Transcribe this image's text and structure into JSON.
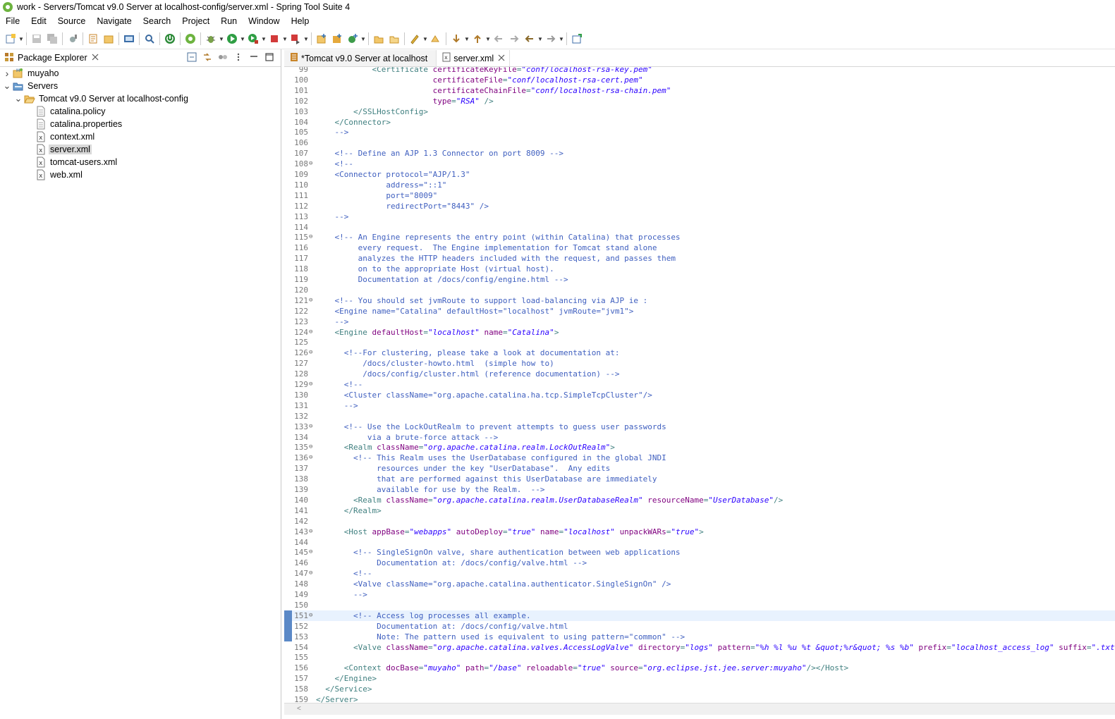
{
  "window": {
    "title": "work - Servers/Tomcat v9.0 Server at localhost-config/server.xml - Spring Tool Suite 4"
  },
  "menu": [
    "File",
    "Edit",
    "Source",
    "Navigate",
    "Search",
    "Project",
    "Run",
    "Window",
    "Help"
  ],
  "package_explorer": {
    "title": "Package Explorer",
    "tree": [
      {
        "label": "muyaho",
        "depth": 0,
        "expanded": false,
        "icon": "project-icon"
      },
      {
        "label": "Servers",
        "depth": 0,
        "expanded": true,
        "icon": "folder-icon"
      },
      {
        "label": "Tomcat v9.0 Server at localhost-config",
        "depth": 1,
        "expanded": true,
        "icon": "folder-open-icon"
      },
      {
        "label": "catalina.policy",
        "depth": 2,
        "icon": "file-icon"
      },
      {
        "label": "catalina.properties",
        "depth": 2,
        "icon": "file-icon"
      },
      {
        "label": "context.xml",
        "depth": 2,
        "icon": "xml-file-icon"
      },
      {
        "label": "server.xml",
        "depth": 2,
        "icon": "xml-file-icon",
        "selected": true
      },
      {
        "label": "tomcat-users.xml",
        "depth": 2,
        "icon": "xml-file-icon"
      },
      {
        "label": "web.xml",
        "depth": 2,
        "icon": "xml-file-icon"
      }
    ]
  },
  "editor": {
    "tabs": [
      {
        "label": "*Tomcat v9.0 Server at localhost",
        "active": false
      },
      {
        "label": "server.xml",
        "active": true
      }
    ],
    "current_line": 151,
    "lines": [
      {
        "n": "99",
        "fold": "",
        "parts": [
          [
            "c",
            "            "
          ],
          [
            "t",
            "<Certificate "
          ],
          [
            "a",
            "certificateKeyFile"
          ],
          [
            "t",
            "="
          ],
          [
            "v",
            "\"conf/localhost-rsa-key.pem\""
          ]
        ]
      },
      {
        "n": "100",
        "fold": "",
        "parts": [
          [
            "c",
            "                         "
          ],
          [
            "a",
            "certificateFile"
          ],
          [
            "t",
            "="
          ],
          [
            "v",
            "\"conf/localhost-rsa-cert.pem\""
          ]
        ]
      },
      {
        "n": "101",
        "fold": "",
        "parts": [
          [
            "c",
            "                         "
          ],
          [
            "a",
            "certificateChainFile"
          ],
          [
            "t",
            "="
          ],
          [
            "v",
            "\"conf/localhost-rsa-chain.pem\""
          ]
        ]
      },
      {
        "n": "102",
        "fold": "",
        "parts": [
          [
            "c",
            "                         "
          ],
          [
            "a",
            "type"
          ],
          [
            "t",
            "="
          ],
          [
            "v",
            "\"RSA\""
          ],
          [
            "t",
            " />"
          ]
        ]
      },
      {
        "n": "103",
        "fold": "",
        "parts": [
          [
            "c",
            "        "
          ],
          [
            "t",
            "</SSLHostConfig>"
          ]
        ]
      },
      {
        "n": "104",
        "fold": "",
        "parts": [
          [
            "c",
            "    "
          ],
          [
            "t",
            "</Connector>"
          ]
        ]
      },
      {
        "n": "105",
        "fold": "",
        "parts": [
          [
            "c",
            "    -->"
          ]
        ]
      },
      {
        "n": "106",
        "fold": "",
        "parts": []
      },
      {
        "n": "107",
        "fold": "",
        "parts": [
          [
            "c",
            "    <!-- Define an AJP 1.3 Connector on port 8009 -->"
          ]
        ]
      },
      {
        "n": "108",
        "fold": "⊖",
        "parts": [
          [
            "c",
            "    <!--"
          ]
        ]
      },
      {
        "n": "109",
        "fold": "",
        "parts": [
          [
            "c",
            "    <Connector protocol=\"AJP/1.3\""
          ]
        ]
      },
      {
        "n": "110",
        "fold": "",
        "parts": [
          [
            "c",
            "               address=\"::1\""
          ]
        ]
      },
      {
        "n": "111",
        "fold": "",
        "parts": [
          [
            "c",
            "               port=\"8009\""
          ]
        ]
      },
      {
        "n": "112",
        "fold": "",
        "parts": [
          [
            "c",
            "               redirectPort=\"8443\" />"
          ]
        ]
      },
      {
        "n": "113",
        "fold": "",
        "parts": [
          [
            "c",
            "    -->"
          ]
        ]
      },
      {
        "n": "114",
        "fold": "",
        "parts": []
      },
      {
        "n": "115",
        "fold": "⊖",
        "parts": [
          [
            "c",
            "    <!-- An Engine represents the entry point (within Catalina) that processes"
          ]
        ]
      },
      {
        "n": "116",
        "fold": "",
        "parts": [
          [
            "c",
            "         every request.  The Engine implementation for Tomcat stand alone"
          ]
        ]
      },
      {
        "n": "117",
        "fold": "",
        "parts": [
          [
            "c",
            "         analyzes the HTTP headers included with the request, and passes them"
          ]
        ]
      },
      {
        "n": "118",
        "fold": "",
        "parts": [
          [
            "c",
            "         on to the appropriate Host (virtual host)."
          ]
        ]
      },
      {
        "n": "119",
        "fold": "",
        "parts": [
          [
            "c",
            "         Documentation at /docs/config/engine.html -->"
          ]
        ]
      },
      {
        "n": "120",
        "fold": "",
        "parts": []
      },
      {
        "n": "121",
        "fold": "⊖",
        "parts": [
          [
            "c",
            "    <!-- You should set jvmRoute to support load-balancing via AJP ie :"
          ]
        ]
      },
      {
        "n": "122",
        "fold": "",
        "parts": [
          [
            "c",
            "    <Engine name=\"Catalina\" defaultHost=\"localhost\" jvmRoute=\"jvm1\">"
          ]
        ]
      },
      {
        "n": "123",
        "fold": "",
        "parts": [
          [
            "c",
            "    -->"
          ]
        ]
      },
      {
        "n": "124",
        "fold": "⊖",
        "parts": [
          [
            "c",
            "    "
          ],
          [
            "t",
            "<Engine "
          ],
          [
            "a",
            "defaultHost"
          ],
          [
            "t",
            "="
          ],
          [
            "v",
            "\"localhost\""
          ],
          [
            "t",
            " "
          ],
          [
            "a",
            "name"
          ],
          [
            "t",
            "="
          ],
          [
            "v",
            "\"Catalina\""
          ],
          [
            "t",
            ">"
          ]
        ]
      },
      {
        "n": "125",
        "fold": "",
        "parts": []
      },
      {
        "n": "126",
        "fold": "⊖",
        "parts": [
          [
            "c",
            "      <!--For clustering, please take a look at documentation at:"
          ]
        ]
      },
      {
        "n": "127",
        "fold": "",
        "parts": [
          [
            "c",
            "          /docs/cluster-howto.html  (simple how to)"
          ]
        ]
      },
      {
        "n": "128",
        "fold": "",
        "parts": [
          [
            "c",
            "          /docs/config/cluster.html (reference documentation) -->"
          ]
        ]
      },
      {
        "n": "129",
        "fold": "⊖",
        "parts": [
          [
            "c",
            "      <!--"
          ]
        ]
      },
      {
        "n": "130",
        "fold": "",
        "parts": [
          [
            "c",
            "      <Cluster className=\"org.apache.catalina.ha.tcp.SimpleTcpCluster\"/>"
          ]
        ]
      },
      {
        "n": "131",
        "fold": "",
        "parts": [
          [
            "c",
            "      -->"
          ]
        ]
      },
      {
        "n": "132",
        "fold": "",
        "parts": []
      },
      {
        "n": "133",
        "fold": "⊖",
        "parts": [
          [
            "c",
            "      <!-- Use the LockOutRealm to prevent attempts to guess user passwords"
          ]
        ]
      },
      {
        "n": "134",
        "fold": "",
        "parts": [
          [
            "c",
            "           via a brute-force attack -->"
          ]
        ]
      },
      {
        "n": "135",
        "fold": "⊖",
        "parts": [
          [
            "c",
            "      "
          ],
          [
            "t",
            "<Realm "
          ],
          [
            "a",
            "className"
          ],
          [
            "t",
            "="
          ],
          [
            "v",
            "\"org.apache.catalina.realm.LockOutRealm\""
          ],
          [
            "t",
            ">"
          ]
        ]
      },
      {
        "n": "136",
        "fold": "⊖",
        "parts": [
          [
            "c",
            "        <!-- This Realm uses the UserDatabase configured in the global JNDI"
          ]
        ]
      },
      {
        "n": "137",
        "fold": "",
        "parts": [
          [
            "c",
            "             resources under the key \"UserDatabase\".  Any edits"
          ]
        ]
      },
      {
        "n": "138",
        "fold": "",
        "parts": [
          [
            "c",
            "             that are performed against this UserDatabase are immediately"
          ]
        ]
      },
      {
        "n": "139",
        "fold": "",
        "parts": [
          [
            "c",
            "             available for use by the Realm.  -->"
          ]
        ]
      },
      {
        "n": "140",
        "fold": "",
        "parts": [
          [
            "c",
            "        "
          ],
          [
            "t",
            "<Realm "
          ],
          [
            "a",
            "className"
          ],
          [
            "t",
            "="
          ],
          [
            "v",
            "\"org.apache.catalina.realm.UserDatabaseRealm\""
          ],
          [
            "t",
            " "
          ],
          [
            "a",
            "resourceName"
          ],
          [
            "t",
            "="
          ],
          [
            "v",
            "\"UserDatabase\""
          ],
          [
            "t",
            "/>"
          ]
        ]
      },
      {
        "n": "141",
        "fold": "",
        "parts": [
          [
            "c",
            "      "
          ],
          [
            "t",
            "</Realm>"
          ]
        ]
      },
      {
        "n": "142",
        "fold": "",
        "parts": []
      },
      {
        "n": "143",
        "fold": "⊖",
        "parts": [
          [
            "c",
            "      "
          ],
          [
            "t",
            "<Host "
          ],
          [
            "a",
            "appBase"
          ],
          [
            "t",
            "="
          ],
          [
            "v",
            "\"webapps\""
          ],
          [
            "t",
            " "
          ],
          [
            "a",
            "autoDeploy"
          ],
          [
            "t",
            "="
          ],
          [
            "v",
            "\"true\""
          ],
          [
            "t",
            " "
          ],
          [
            "a",
            "name"
          ],
          [
            "t",
            "="
          ],
          [
            "v",
            "\"localhost\""
          ],
          [
            "t",
            " "
          ],
          [
            "a",
            "unpackWARs"
          ],
          [
            "t",
            "="
          ],
          [
            "v",
            "\"true\""
          ],
          [
            "t",
            ">"
          ]
        ]
      },
      {
        "n": "144",
        "fold": "",
        "parts": []
      },
      {
        "n": "145",
        "fold": "⊖",
        "parts": [
          [
            "c",
            "        <!-- SingleSignOn valve, share authentication between web applications"
          ]
        ]
      },
      {
        "n": "146",
        "fold": "",
        "parts": [
          [
            "c",
            "             Documentation at: /docs/config/valve.html -->"
          ]
        ]
      },
      {
        "n": "147",
        "fold": "⊖",
        "parts": [
          [
            "c",
            "        <!--"
          ]
        ]
      },
      {
        "n": "148",
        "fold": "",
        "parts": [
          [
            "c",
            "        <Valve className=\"org.apache.catalina.authenticator.SingleSignOn\" />"
          ]
        ]
      },
      {
        "n": "149",
        "fold": "",
        "parts": [
          [
            "c",
            "        -->"
          ]
        ]
      },
      {
        "n": "150",
        "fold": "",
        "parts": []
      },
      {
        "n": "151",
        "fold": "⊖",
        "parts": [
          [
            "c",
            "        <!-- Access log processes all example."
          ]
        ]
      },
      {
        "n": "152",
        "fold": "",
        "parts": [
          [
            "c",
            "             Documentation at: /docs/config/valve.html"
          ]
        ]
      },
      {
        "n": "153",
        "fold": "",
        "parts": [
          [
            "c",
            "             Note: The pattern used is equivalent to using pattern=\"common\" -->"
          ]
        ]
      },
      {
        "n": "154",
        "fold": "",
        "parts": [
          [
            "c",
            "        "
          ],
          [
            "t",
            "<Valve "
          ],
          [
            "a",
            "className"
          ],
          [
            "t",
            "="
          ],
          [
            "v",
            "\"org.apache.catalina.valves.AccessLogValve\""
          ],
          [
            "t",
            " "
          ],
          [
            "a",
            "directory"
          ],
          [
            "t",
            "="
          ],
          [
            "v",
            "\"logs\""
          ],
          [
            "t",
            " "
          ],
          [
            "a",
            "pattern"
          ],
          [
            "t",
            "="
          ],
          [
            "v",
            "\"%h %l %u %t &quot;%r&quot; %s %b\""
          ],
          [
            "t",
            " "
          ],
          [
            "a",
            "prefix"
          ],
          [
            "t",
            "="
          ],
          [
            "v",
            "\"localhost_access_log\""
          ],
          [
            "t",
            " "
          ],
          [
            "a",
            "suffix"
          ],
          [
            "t",
            "="
          ],
          [
            "v",
            "\".txt\""
          ],
          [
            "t",
            "/>"
          ]
        ]
      },
      {
        "n": "155",
        "fold": "",
        "parts": []
      },
      {
        "n": "156",
        "fold": "",
        "parts": [
          [
            "c",
            "      "
          ],
          [
            "t",
            "<Context "
          ],
          [
            "a",
            "docBase"
          ],
          [
            "t",
            "="
          ],
          [
            "v",
            "\"muyaho\""
          ],
          [
            "t",
            " "
          ],
          [
            "a",
            "path"
          ],
          [
            "t",
            "="
          ],
          [
            "v",
            "\"/base\""
          ],
          [
            "t",
            " "
          ],
          [
            "a",
            "reloadable"
          ],
          [
            "t",
            "="
          ],
          [
            "v",
            "\"true\""
          ],
          [
            "t",
            " "
          ],
          [
            "a",
            "source"
          ],
          [
            "t",
            "="
          ],
          [
            "v",
            "\"org.eclipse.jst.jee.server:muyaho\""
          ],
          [
            "t",
            "/></Host>"
          ]
        ]
      },
      {
        "n": "157",
        "fold": "",
        "parts": [
          [
            "c",
            "    "
          ],
          [
            "t",
            "</Engine>"
          ]
        ]
      },
      {
        "n": "158",
        "fold": "",
        "parts": [
          [
            "c",
            "  "
          ],
          [
            "t",
            "</Service>"
          ]
        ]
      },
      {
        "n": "159",
        "fold": "",
        "parts": [
          [
            "t",
            "</Server>"
          ]
        ]
      }
    ]
  },
  "colors": {
    "comment": "#3f5fbf",
    "tag": "#3f7f7f",
    "attribute": "#7f007f",
    "value": "#2a00ff",
    "current_line": "#e8f2fe",
    "selection": "#d9d9d9"
  }
}
